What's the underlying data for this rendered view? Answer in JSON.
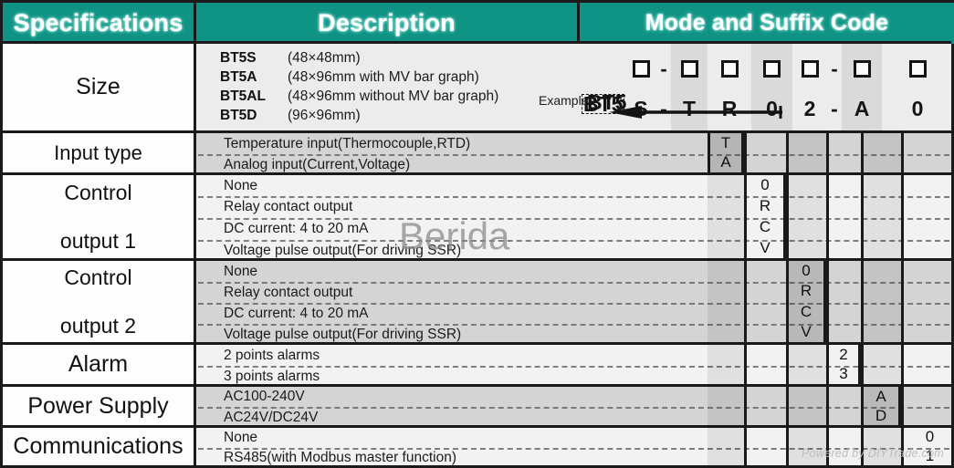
{
  "header": {
    "specifications": "Specifications",
    "description": "Description",
    "mode_and_suffix": "Mode and Suffix Code"
  },
  "code_diagram": {
    "base": "BT5",
    "example_label": "Example",
    "example_base": "BT5",
    "dash": "-",
    "slots": [
      {
        "name": "model",
        "example": "S"
      },
      {
        "name": "input-type",
        "example": "T"
      },
      {
        "name": "control-out-1",
        "example": "R"
      },
      {
        "name": "control-out-2",
        "example": "0"
      },
      {
        "name": "alarm",
        "example": "2"
      },
      {
        "name": "power-supply",
        "example": "A"
      },
      {
        "name": "communications",
        "example": "0"
      }
    ]
  },
  "rows": [
    {
      "spec": "Size",
      "spec_lines": [
        "Size"
      ],
      "shade": "light",
      "models": [
        {
          "code": "BT5S",
          "note": "(48×48mm)"
        },
        {
          "code": "BT5A",
          "note": "(48×96mm  with MV bar graph)"
        },
        {
          "code": "BT5AL",
          "note": "(48×96mm  without MV bar graph)"
        },
        {
          "code": "BT5D",
          "note": "(96×96mm)"
        }
      ]
    },
    {
      "spec": "Input type",
      "spec_lines": [
        "Input type"
      ],
      "shade": "dark",
      "options": [
        "Temperature input(Thermocouple,RTD)",
        "Analog input(Current,Voltage)"
      ],
      "codes": [
        "T",
        "A"
      ]
    },
    {
      "spec": "Control output 1",
      "spec_lines": [
        "Control",
        "output 1"
      ],
      "shade": "light",
      "options": [
        "None",
        "Relay contact output",
        "DC current: 4 to 20 mA",
        "Voltage pulse output(For driving SSR)"
      ],
      "codes": [
        "0",
        "R",
        "C",
        "V"
      ]
    },
    {
      "spec": "Control output 2",
      "spec_lines": [
        "Control",
        "output 2"
      ],
      "shade": "dark",
      "options": [
        "None",
        "Relay contact output",
        "DC current: 4 to 20 mA",
        "Voltage pulse output(For driving SSR)"
      ],
      "codes": [
        "0",
        "R",
        "C",
        "V"
      ]
    },
    {
      "spec": "Alarm",
      "spec_lines": [
        "Alarm"
      ],
      "shade": "light",
      "options": [
        "2 points alarms",
        "3 points alarms"
      ],
      "codes": [
        "2",
        "3"
      ]
    },
    {
      "spec": "Power Supply",
      "spec_lines": [
        "Power Supply"
      ],
      "shade": "dark",
      "options": [
        "AC100-240V",
        "AC24V/DC24V"
      ],
      "codes": [
        "A",
        "D"
      ]
    },
    {
      "spec": "Communications",
      "spec_lines": [
        "Communications"
      ],
      "shade": "light",
      "options": [
        "None",
        "RS485(with Modbus master function)"
      ],
      "codes": [
        "0",
        "1"
      ]
    }
  ],
  "watermarks": {
    "brand": "Berida",
    "footer": "Powered by DIYTrade.com"
  },
  "colors": {
    "header_teal": "#0e9384",
    "header_text": "#ffffff",
    "rule": "#1a1a1a",
    "row_light": "#f2f2f2",
    "row_dark": "#d4d4d4"
  }
}
